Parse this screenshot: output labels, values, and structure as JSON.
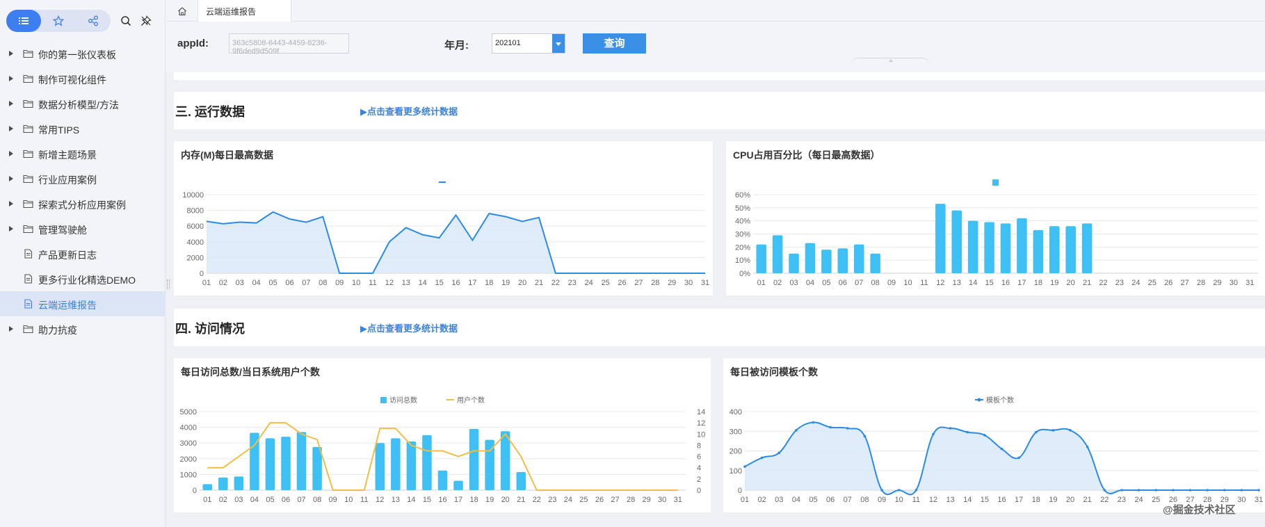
{
  "sidebar": {
    "toolbar": {
      "list_icon": "list-icon",
      "star_icon": "star-icon",
      "share_icon": "share-icon",
      "search_icon": "search-icon",
      "pin_icon": "pin-icon"
    },
    "items": [
      {
        "label": "你的第一张仪表板",
        "type": "folder",
        "expandable": true
      },
      {
        "label": "制作可视化组件",
        "type": "folder",
        "expandable": true
      },
      {
        "label": "数据分析模型/方法",
        "type": "folder",
        "expandable": true
      },
      {
        "label": "常用TIPS",
        "type": "folder",
        "expandable": true
      },
      {
        "label": "新增主题场景",
        "type": "folder",
        "expandable": true
      },
      {
        "label": "行业应用案例",
        "type": "folder",
        "expandable": true
      },
      {
        "label": "探索式分析应用案例",
        "type": "folder",
        "expandable": true
      },
      {
        "label": "管理驾驶舱",
        "type": "folder",
        "expandable": true
      },
      {
        "label": "产品更新日志",
        "type": "document",
        "expandable": false
      },
      {
        "label": "更多行业化精选DEMO",
        "type": "document",
        "expandable": false
      },
      {
        "label": "云端运维报告",
        "type": "document",
        "expandable": false,
        "active": true
      },
      {
        "label": "助力抗疫",
        "type": "folder",
        "expandable": true
      }
    ]
  },
  "tabs": {
    "home_icon": "home-icon",
    "active_tab": "云端运维报告"
  },
  "filters": {
    "appid_label": "appId:",
    "appid_value": "363c5808-6443-4459-8236-9f6ded9d509f",
    "ym_label": "年月:",
    "ym_value": "202101",
    "query_button": "查询"
  },
  "section3": {
    "title": "三. 运行数据",
    "link": "▶点击查看更多统计数据"
  },
  "section4": {
    "title": "四. 访问情况",
    "link": "▶点击查看更多统计数据"
  },
  "colors": {
    "accent": "#3a90e6",
    "bar": "#3ec0f4",
    "line": "#2b8ae6",
    "area": "#d9e9f8",
    "user_line": "#f3bd43"
  },
  "watermark": "@掘金技术社区",
  "chart_data": [
    {
      "id": "memory",
      "type": "area",
      "title": "内存(M)每日最高数据",
      "categories": [
        "01",
        "02",
        "03",
        "04",
        "05",
        "06",
        "07",
        "08",
        "09",
        "10",
        "11",
        "12",
        "13",
        "14",
        "15",
        "16",
        "17",
        "18",
        "19",
        "20",
        "21",
        "22",
        "23",
        "24",
        "25",
        "26",
        "27",
        "28",
        "29",
        "30",
        "31"
      ],
      "series": [
        {
          "values": [
            6600,
            6300,
            6500,
            6400,
            7800,
            6900,
            6500,
            7200,
            0,
            0,
            0,
            4000,
            5800,
            4900,
            4500,
            7400,
            4200,
            7600,
            7200,
            6600,
            7100,
            0,
            0,
            0,
            0,
            0,
            0,
            0,
            0,
            0,
            0
          ]
        }
      ],
      "yticks": [
        "0",
        "2000",
        "4000",
        "6000",
        "8000",
        "10000"
      ],
      "ylim": [
        0,
        10000
      ],
      "grid": true,
      "legend_marker": "line"
    },
    {
      "id": "cpu",
      "type": "bar",
      "title": "CPU占用百分比（每日最高数据）",
      "categories": [
        "01",
        "02",
        "03",
        "04",
        "05",
        "06",
        "07",
        "08",
        "09",
        "10",
        "11",
        "12",
        "13",
        "14",
        "15",
        "16",
        "17",
        "18",
        "19",
        "20",
        "21",
        "22",
        "23",
        "24",
        "25",
        "26",
        "27",
        "28",
        "29",
        "30",
        "31"
      ],
      "series": [
        {
          "values": [
            22,
            29,
            15,
            23,
            18,
            19,
            22,
            15,
            0,
            0,
            0,
            53,
            48,
            40,
            39,
            38,
            42,
            33,
            36,
            36,
            38,
            0,
            0,
            0,
            0,
            0,
            0,
            0,
            0,
            0,
            0
          ]
        }
      ],
      "yticks": [
        "0%",
        "10%",
        "20%",
        "30%",
        "40%",
        "50%",
        "60%"
      ],
      "ylim": [
        0,
        60
      ],
      "grid": true,
      "legend_marker": "square"
    },
    {
      "id": "visits",
      "type": "bar",
      "title": "每日访问总数/当日系统用户个数",
      "categories": [
        "01",
        "02",
        "03",
        "04",
        "05",
        "06",
        "07",
        "08",
        "09",
        "10",
        "11",
        "12",
        "13",
        "14",
        "15",
        "16",
        "17",
        "18",
        "19",
        "20",
        "21",
        "22",
        "23",
        "24",
        "25",
        "26",
        "27",
        "28",
        "29",
        "30",
        "31"
      ],
      "series": [
        {
          "name": "访问总数",
          "type": "bar",
          "axis": "left",
          "values": [
            380,
            800,
            870,
            3650,
            3300,
            3400,
            3700,
            2750,
            0,
            0,
            0,
            3000,
            3300,
            3100,
            3500,
            1250,
            600,
            3900,
            3200,
            3750,
            1150,
            0,
            0,
            0,
            0,
            0,
            0,
            0,
            0,
            0,
            0
          ]
        },
        {
          "name": "用户个数",
          "type": "line",
          "axis": "right",
          "values": [
            4,
            4,
            6,
            8,
            12,
            12,
            10,
            9,
            0,
            0,
            0,
            11,
            11,
            8,
            7,
            7,
            6,
            7,
            7,
            10,
            6,
            0,
            0,
            0,
            0,
            0,
            0,
            0,
            0,
            0,
            0
          ]
        }
      ],
      "yticks_left": [
        "0",
        "1000",
        "2000",
        "3000",
        "4000",
        "5000"
      ],
      "yticks_right": [
        "0",
        "2",
        "4",
        "6",
        "8",
        "10",
        "12",
        "14"
      ],
      "ylim_left": [
        0,
        5000
      ],
      "ylim_right": [
        0,
        14
      ],
      "legend_position": "top-center"
    },
    {
      "id": "templates",
      "type": "area",
      "title": "每日被访问模板个数",
      "categories": [
        "01",
        "02",
        "03",
        "04",
        "05",
        "06",
        "07",
        "08",
        "09",
        "10",
        "11",
        "12",
        "13",
        "14",
        "15",
        "16",
        "17",
        "18",
        "19",
        "20",
        "21",
        "22",
        "23",
        "24",
        "25",
        "26",
        "27",
        "28",
        "29",
        "30",
        "31"
      ],
      "series": [
        {
          "name": "模板个数",
          "values": [
            120,
            165,
            190,
            305,
            345,
            320,
            315,
            275,
            0,
            0,
            0,
            285,
            315,
            295,
            280,
            210,
            165,
            295,
            305,
            305,
            220,
            0,
            0,
            0,
            0,
            0,
            0,
            0,
            0,
            0,
            0
          ]
        }
      ],
      "yticks": [
        "0",
        "100",
        "200",
        "300",
        "400"
      ],
      "ylim": [
        0,
        400
      ],
      "smooth": true,
      "legend_position": "top-center"
    }
  ]
}
